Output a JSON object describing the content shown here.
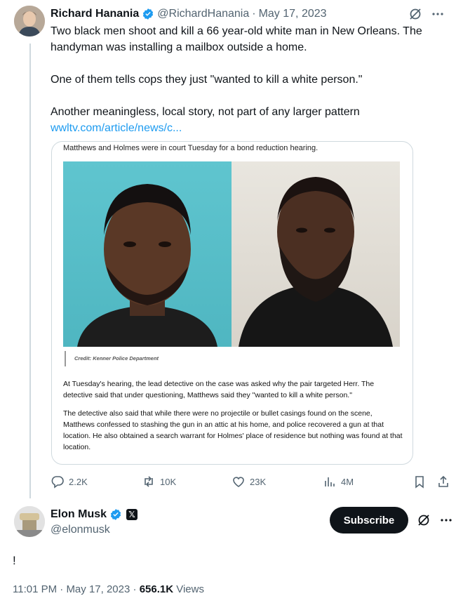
{
  "quoted_tweet": {
    "author_name": "Richard Hanania",
    "author_handle": "@RichardHanania",
    "date": "May 17, 2023",
    "paragraphs": [
      "Two black men shoot and kill a 66 year-old white man in New Orleans. The handyman was installing a mailbox outside a home.",
      "One of them tells cops they just \"wanted to kill a white person.\"",
      "Another meaningless, local story, not part of any larger pattern"
    ],
    "link_text": "wwltv.com/article/news/c...",
    "media": {
      "caption": "Matthews and Holmes were in court Tuesday for a bond reduction hearing.",
      "credit": "Credit: Kenner Police Department",
      "body_1": "At Tuesday's hearing, the lead detective on the case was asked why the pair targeted Herr. The detective said that under questioning, Matthews said they \"wanted to kill a white person.\"",
      "body_2": "The detective also said that while there were no projectile or bullet casings found on the scene, Matthews confessed to stashing the gun in an attic at his home, and police recovered a gun at that location. He also obtained a search warrant for Holmes' place of residence but nothing was found at that location."
    },
    "stats": {
      "replies": "2.2K",
      "retweets": "10K",
      "likes": "23K",
      "views": "4M"
    },
    "icons": [
      "grok-icon",
      "more-icon",
      "reply-icon",
      "retweet-icon",
      "like-icon",
      "views-icon",
      "bookmark-icon",
      "share-icon"
    ]
  },
  "main_tweet": {
    "author_name": "Elon Musk",
    "author_handle": "@elonmusk",
    "subscribe_label": "Subscribe",
    "text": "!",
    "time": "11:01 PM",
    "date": "May 17, 2023",
    "views_count": "656.1K",
    "views_label": "Views",
    "affiliate_badge": "𝕏"
  },
  "colors": {
    "verified": "#1d9bf0",
    "link": "#1d9bf0",
    "secondary_text": "#536471",
    "primary_text": "#0f1419",
    "border": "#cfd9de"
  }
}
